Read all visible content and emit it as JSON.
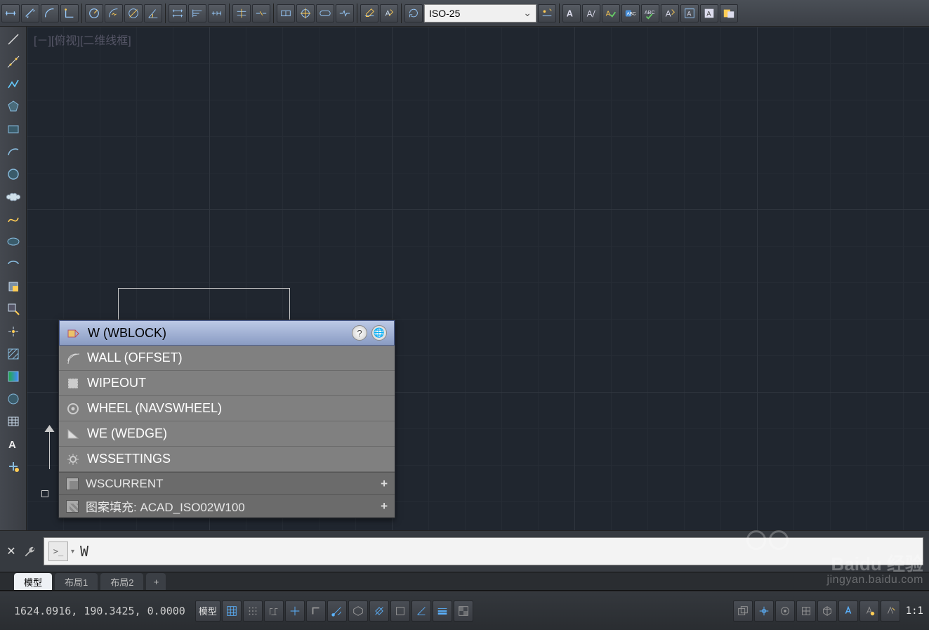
{
  "dimstyle": {
    "selected": "ISO-25"
  },
  "viewport_label": {
    "minus": "[－]",
    "view": "[俯视]",
    "style": "[二维线框]"
  },
  "autocomplete": {
    "items": [
      {
        "label": "W (WBLOCK)",
        "selected": true
      },
      {
        "label": "WALL (OFFSET)"
      },
      {
        "label": "WIPEOUT"
      },
      {
        "label": "WHEEL (NAVSWHEEL)"
      },
      {
        "label": "WE (WEDGE)"
      },
      {
        "label": "WSSETTINGS"
      }
    ],
    "footer": [
      {
        "label": "WSCURRENT"
      },
      {
        "label": "图案填充: ACAD_ISO02W100"
      }
    ]
  },
  "command_input": {
    "text": "W"
  },
  "tabs": {
    "items": [
      "模型",
      "布局1",
      "布局2"
    ],
    "active": 0,
    "plus": "+"
  },
  "status": {
    "coords": "1624.0916, 190.3425, 0.0000",
    "model_btn": "模型",
    "ratio": "1:1"
  },
  "watermark": {
    "brand": "Baidu 经验",
    "url": "jingyan.baidu.com"
  }
}
